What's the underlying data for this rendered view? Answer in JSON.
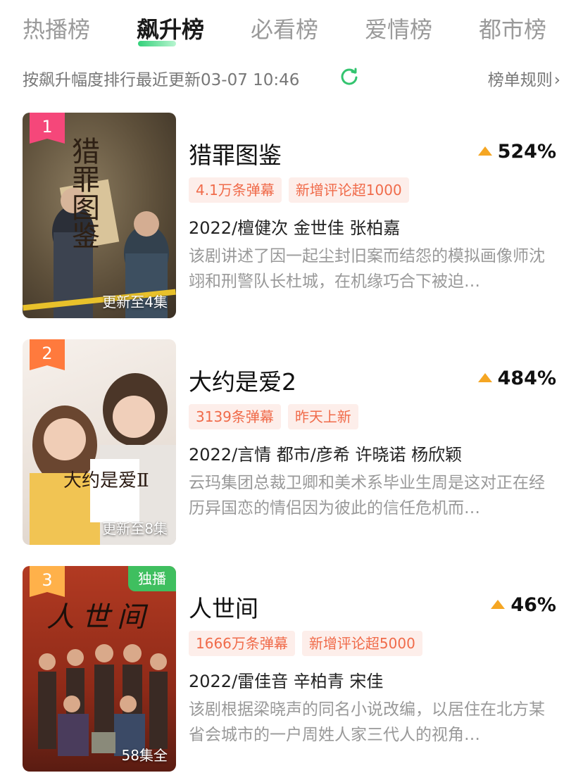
{
  "tabs": [
    {
      "label": "热播榜"
    },
    {
      "label": "飙升榜"
    },
    {
      "label": "必看榜"
    },
    {
      "label": "爱情榜"
    },
    {
      "label": "都市榜"
    }
  ],
  "active_tab": "飙升榜",
  "subheader": {
    "text": "按飙升幅度排行最近更新03-07 10:46",
    "refresh_icon": "refresh-icon",
    "rules_label": "榜单规则",
    "rules_icon": "chevron-right-icon"
  },
  "accent_color": "#33d17a",
  "items": [
    {
      "rank": "1",
      "title": "猎罪图鉴",
      "trend": "524%",
      "tags": [
        "4.1万条弹幕",
        "新增评论超1000"
      ],
      "meta": "2022/檀健次 金世佳 张柏嘉",
      "desc": "该剧讲述了因一起尘封旧案而结怨的模拟画像师沈翊和刑警队长杜城，在机缘巧合下被迫…",
      "episodes": "更新至4集",
      "poster_title": "猎罪图鉴",
      "exclusive": ""
    },
    {
      "rank": "2",
      "title": "大约是爱2",
      "trend": "484%",
      "tags": [
        "3139条弹幕",
        "昨天上新"
      ],
      "meta": "2022/言情 都市/彦希 许晓诺 杨欣颖",
      "desc": "云玛集团总裁卫卿和美术系毕业生周是这对正在经历异国恋的情侣因为彼此的信任危机而…",
      "episodes": "更新至8集",
      "poster_title": "大约是爱Ⅱ",
      "exclusive": ""
    },
    {
      "rank": "3",
      "title": "人世间",
      "trend": "46%",
      "tags": [
        "1666万条弹幕",
        "新增评论超5000"
      ],
      "meta": "2022/雷佳音 辛柏青 宋佳",
      "desc": "该剧根据梁晓声的同名小说改编，以居住在北方某省会城市的一户周姓人家三代人的视角…",
      "episodes": "58集全",
      "poster_title": "人世间",
      "exclusive": "独播"
    }
  ]
}
